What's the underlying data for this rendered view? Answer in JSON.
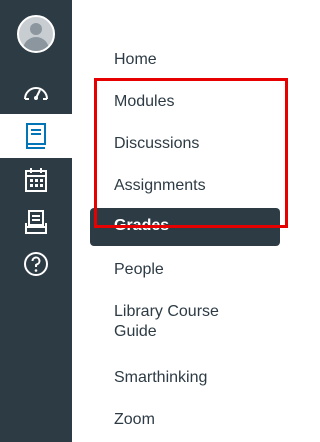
{
  "global_nav": {
    "items": [
      {
        "name": "account",
        "icon": "user-avatar-icon"
      },
      {
        "name": "dashboard",
        "icon": "dashboard-gauge-icon"
      },
      {
        "name": "courses",
        "icon": "book-icon",
        "active": true
      },
      {
        "name": "calendar",
        "icon": "calendar-icon"
      },
      {
        "name": "inbox",
        "icon": "inbox-icon"
      },
      {
        "name": "help",
        "icon": "help-icon"
      }
    ]
  },
  "course_nav": {
    "items": [
      {
        "label": "Home"
      },
      {
        "label": "Modules"
      },
      {
        "label": "Discussions"
      },
      {
        "label": "Assignments"
      },
      {
        "label": "Grades",
        "active": true
      },
      {
        "label": "People"
      },
      {
        "label": "Library Course Guide"
      },
      {
        "label": "Smarthinking"
      },
      {
        "label": "Zoom"
      }
    ]
  },
  "colors": {
    "rail_bg": "#2d3b45",
    "active_bg": "#2d3b45",
    "highlight": "#e60000",
    "text": "#2d3b45"
  }
}
